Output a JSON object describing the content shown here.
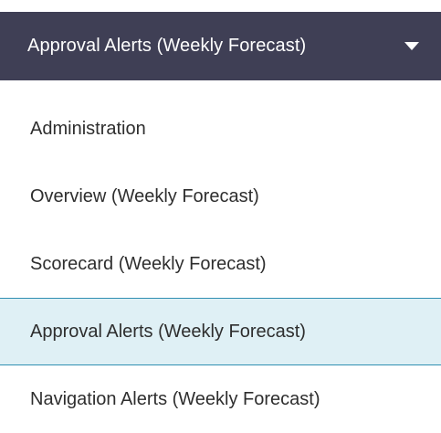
{
  "selector": {
    "label": "Approval Alerts (Weekly Forecast)",
    "icon": "chevron-down-icon"
  },
  "menu": {
    "items": [
      {
        "label": "Administration",
        "active": false
      },
      {
        "label": "Overview (Weekly Forecast)",
        "active": false
      },
      {
        "label": "Scorecard (Weekly Forecast)",
        "active": false
      },
      {
        "label": "Approval Alerts (Weekly Forecast)",
        "active": true
      },
      {
        "label": "Navigation Alerts (Weekly Forecast)",
        "active": false
      }
    ]
  },
  "colors": {
    "selector_bg": "#3f3f55",
    "active_bg": "#dff0f5",
    "active_border": "#2f8fb2"
  }
}
